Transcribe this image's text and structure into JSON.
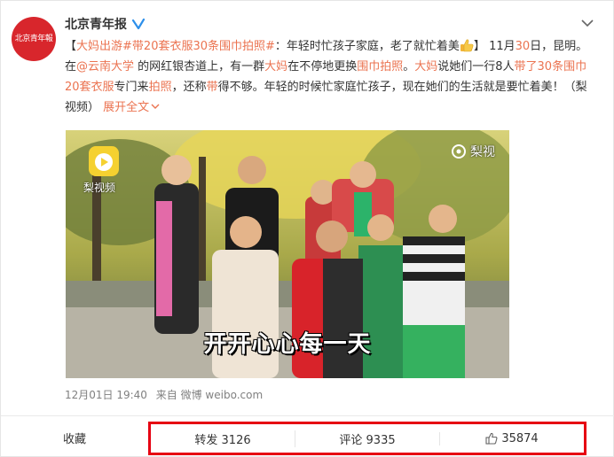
{
  "account": {
    "name": "北京青年报",
    "avatar_text": "北京青年報"
  },
  "post": {
    "p1": "【",
    "tag1": "大妈出游",
    "tag2": "#带20套衣服30条围巾拍照#",
    "p2": "：年轻时忙孩子家庭，老了就忙着美",
    "p3": "】",
    "p4": "11月",
    "d30": "30",
    "p5": "日，昆明。在",
    "mention": "@云南大学",
    "p6": " 的网红银杏道上，有一群",
    "w_dama1": "大妈",
    "p7": "在不停地更换",
    "w_weijin": "围巾拍照",
    "p8": "。",
    "w_dama2": "大妈",
    "p9": "说她们一行8人",
    "w_dai": "带了30条围巾20套衣服",
    "p10": "专门来",
    "w_paizhao": "拍照",
    "p11": "，还称",
    "w_dai2": "带",
    "p12": "得不够。年轻的时候忙家庭忙孩子，现在她们的生活就是要忙着美！（梨视频）",
    "expand": "展开全文"
  },
  "video": {
    "logo_label": "梨视频",
    "watermark": "梨视",
    "caption": "开开心心每一天"
  },
  "meta": {
    "time": "12月01日 19:40",
    "from": "来自",
    "source": "微博 weibo.com"
  },
  "actions": {
    "favorite": "收藏",
    "repost": "转发 3126",
    "comment": "评论 9335",
    "like": "35874"
  },
  "colors": {
    "accent": "#eb7350",
    "highlight_box": "#e60012",
    "avatar": "#d8262c"
  }
}
